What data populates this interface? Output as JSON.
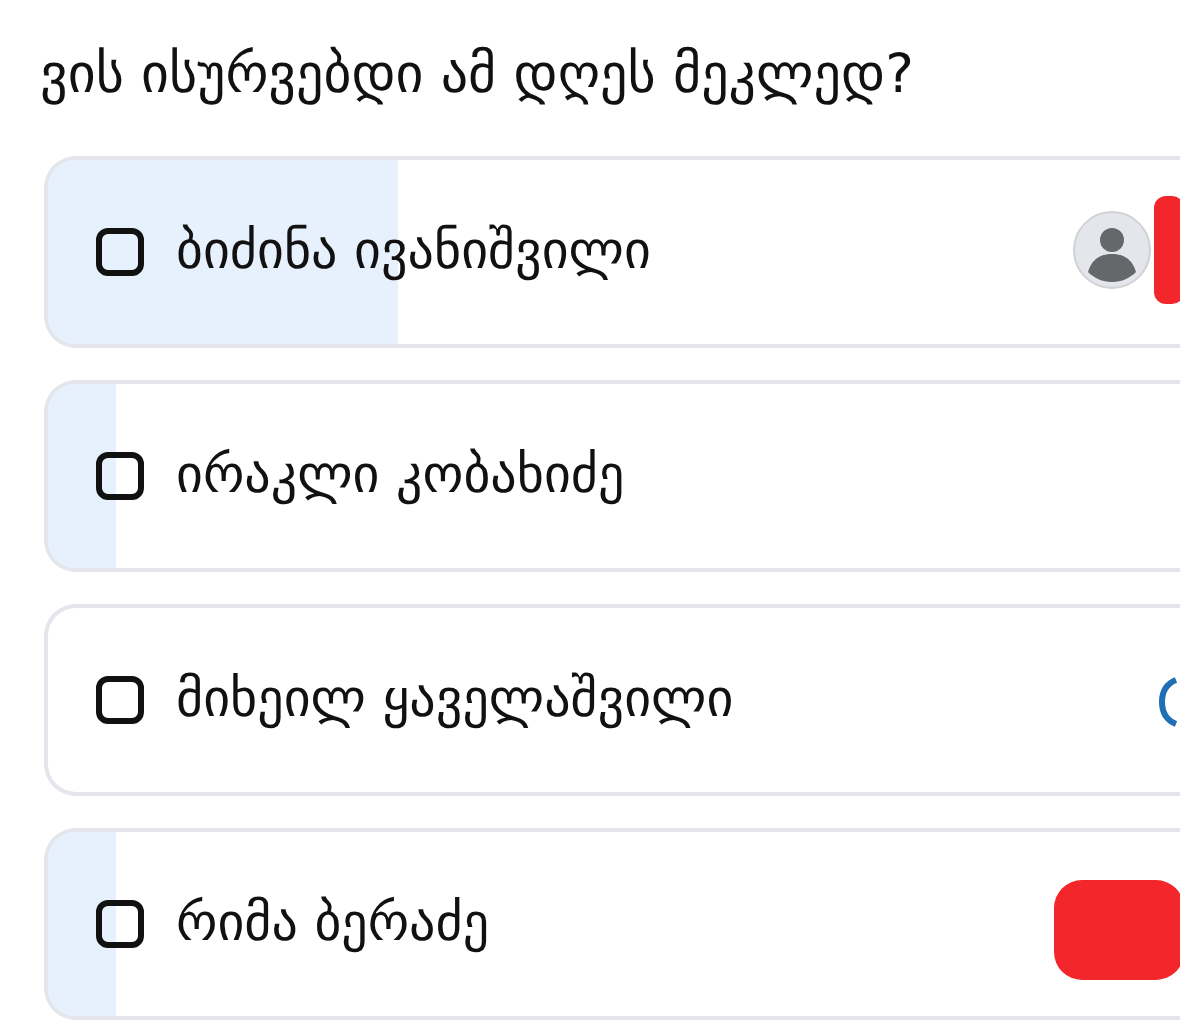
{
  "question": "ვის ისურვებდი ამ დღეს მეკლედ?",
  "options": [
    {
      "label": "ბიძინა ივანიშვილი",
      "checked": false,
      "level": 0.31,
      "kind": "avatar_redacted"
    },
    {
      "label": "ირაკლი კობახიძე",
      "checked": false,
      "level": 0.06,
      "kind": "plain"
    },
    {
      "label": "მიხეილ ყაველაშვილი",
      "checked": false,
      "level": 0,
      "kind": "partial"
    },
    {
      "label": "რიმა ბერაძე",
      "checked": false,
      "level": 0.06,
      "kind": "redacted"
    }
  ]
}
